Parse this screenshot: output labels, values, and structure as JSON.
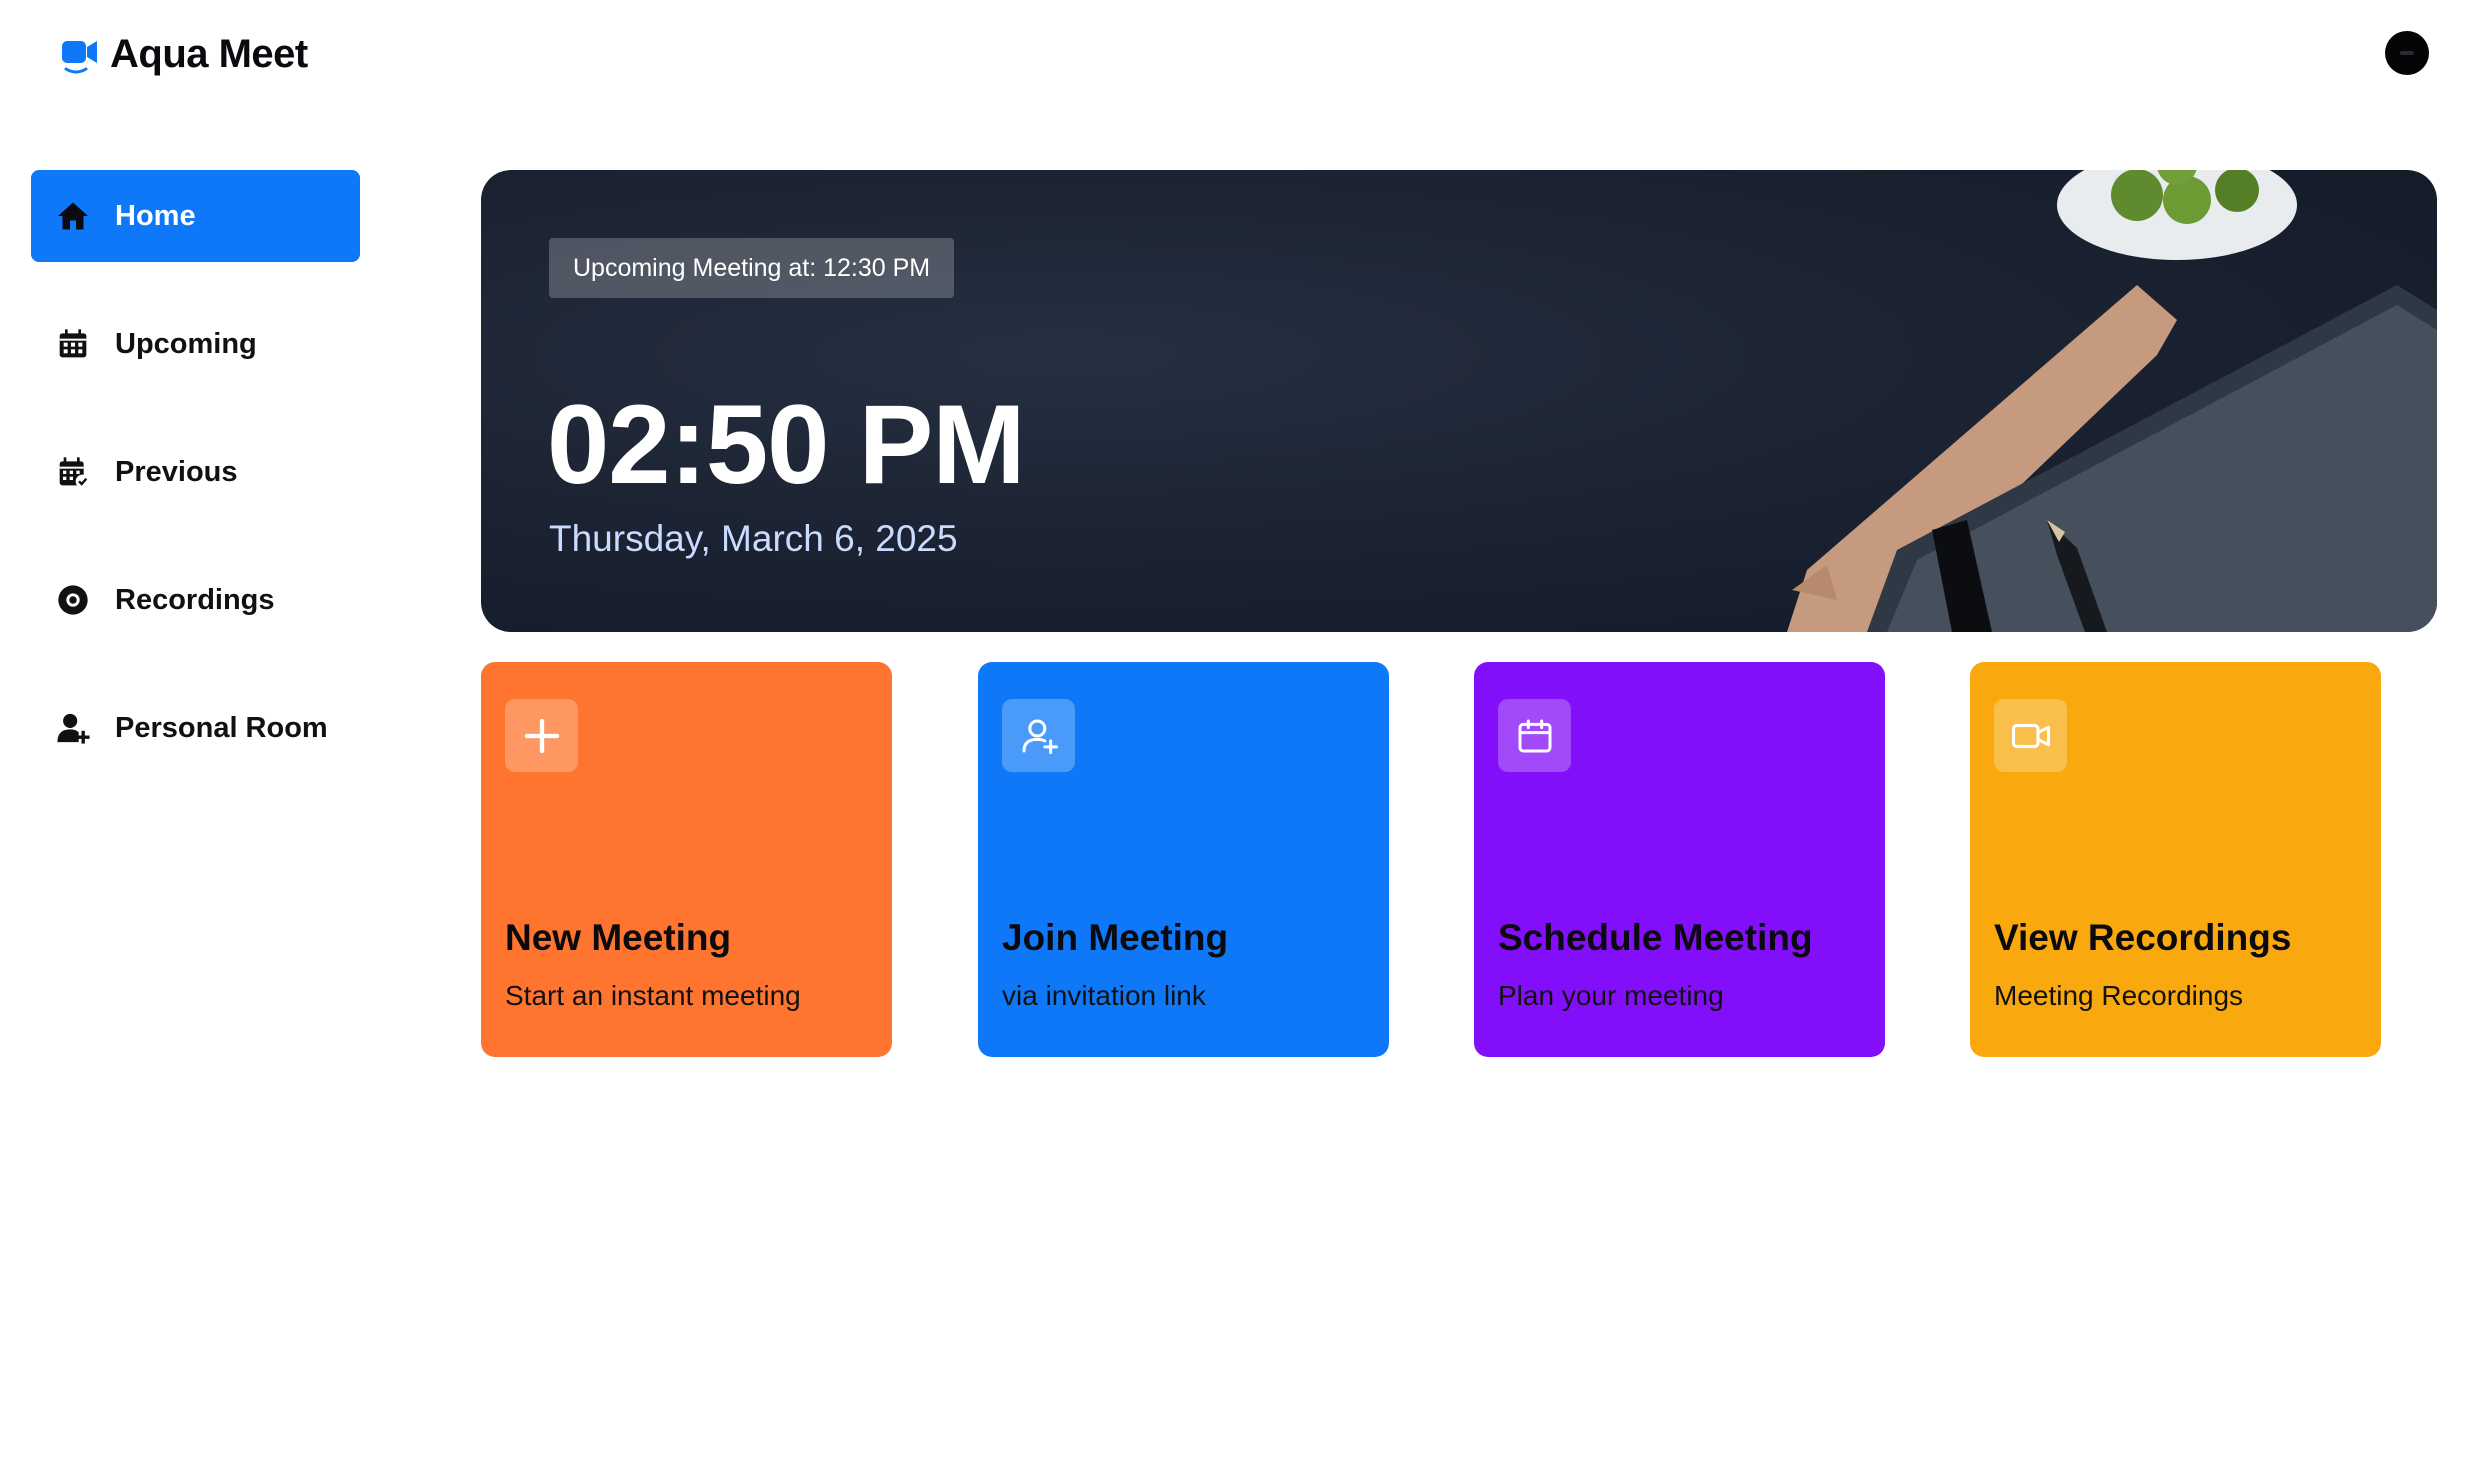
{
  "app": {
    "name": "Aqua Meet",
    "brand_icon": "video-camera-icon",
    "accent": "#0E78F9",
    "avatar": "user-avatar"
  },
  "sidebar": {
    "items": [
      {
        "label": "Home",
        "icon": "home-icon",
        "active": true
      },
      {
        "label": "Upcoming",
        "icon": "calendar-icon",
        "active": false
      },
      {
        "label": "Previous",
        "icon": "calendar-check-icon",
        "active": false
      },
      {
        "label": "Recordings",
        "icon": "record-icon",
        "active": false
      },
      {
        "label": "Personal Room",
        "icon": "user-plus-icon",
        "active": false
      }
    ]
  },
  "hero": {
    "badge": "Upcoming Meeting at: 12:30 PM",
    "time": "02:50 PM",
    "date": "Thursday, March 6, 2025"
  },
  "cards": [
    {
      "title": "New Meeting",
      "subtitle": "Start an instant meeting",
      "icon": "plus-icon",
      "color": "#FF742E"
    },
    {
      "title": "Join Meeting",
      "subtitle": "via invitation link",
      "icon": "user-add-icon",
      "color": "#0E78F9"
    },
    {
      "title": "Schedule Meeting",
      "subtitle": "Plan your meeting",
      "icon": "calendar-icon",
      "color": "#830EF9"
    },
    {
      "title": "View Recordings",
      "subtitle": "Meeting Recordings",
      "icon": "video-icon",
      "color": "#F9A90E"
    }
  ]
}
